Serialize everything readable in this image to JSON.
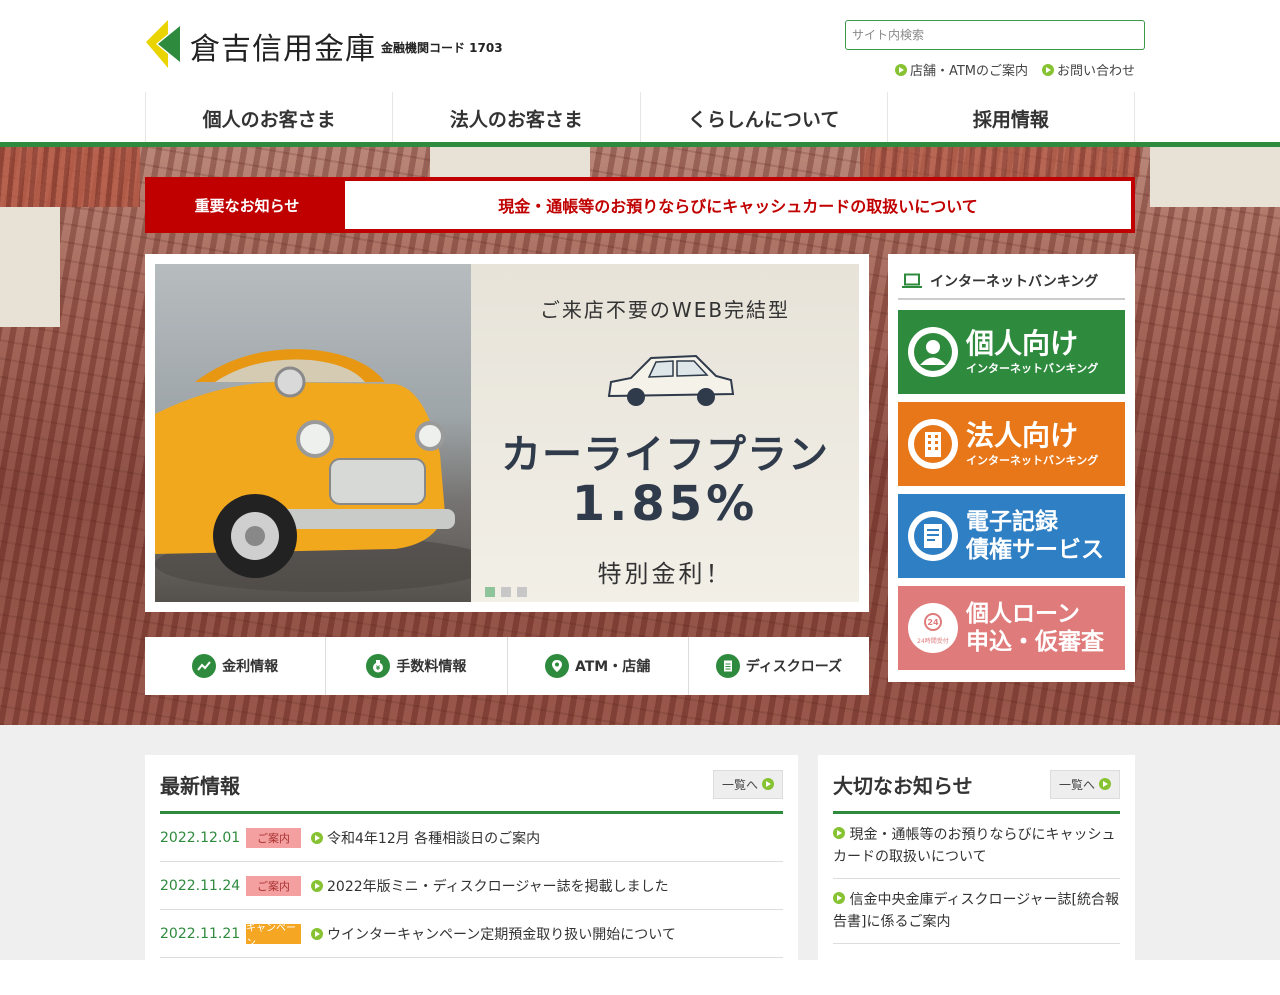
{
  "header": {
    "logo_name": "倉吉信用金庫",
    "bank_code": "金融機関コード 1703",
    "search_placeholder": "サイト内検索",
    "util_links": [
      "店舗・ATMのご案内",
      "お問い合わせ"
    ]
  },
  "nav": [
    "個人のお客さま",
    "法人のお客さま",
    "くらしんについて",
    "採用情報"
  ],
  "notice": {
    "label": "重要なお知らせ",
    "text": "現金・通帳等のお預りならびにキャッシュカードの取扱いについて"
  },
  "slider": {
    "subtitle": "ご来店不要のWEB完結型",
    "title": "カーライフプラン",
    "rate": "1.85%",
    "note": "特別金利！",
    "dots": 3,
    "active_dot": 0
  },
  "quick_links": [
    {
      "label": "金利情報",
      "icon": "chart-icon"
    },
    {
      "label": "手数料情報",
      "icon": "money-bag-icon"
    },
    {
      "label": "ATM・店舗",
      "icon": "map-pin-icon"
    },
    {
      "label": "ディスクローズ",
      "icon": "document-icon"
    }
  ],
  "internet_banking": {
    "heading": "インターネットバンキング",
    "buttons": [
      {
        "title": "個人向け",
        "sub": "インターネットバンキング",
        "color": "#2e8b3e",
        "icon": "person-icon"
      },
      {
        "title": "法人向け",
        "sub": "インターネットバンキング",
        "color": "#e8771a",
        "icon": "building-icon"
      },
      {
        "line1": "電子記録",
        "line2": "債権サービス",
        "color": "#2f7fc4",
        "icon": "e-document-icon"
      },
      {
        "line1": "個人ローン",
        "line2": "申込・仮審査",
        "color": "#e07b7b",
        "icon": "24h-clock-icon",
        "badge": "24時間受付"
      }
    ]
  },
  "news": {
    "title": "最新情報",
    "more": "一覧へ",
    "items": [
      {
        "date": "2022.12.01",
        "tag": "ご案内",
        "tag_color": "#f4a0a0",
        "title": "令和4年12月 各種相談日のご案内"
      },
      {
        "date": "2022.11.24",
        "tag": "ご案内",
        "tag_color": "#f4a0a0",
        "title": "2022年版ミニ・ディスクロージャー誌を掲載しました"
      },
      {
        "date": "2022.11.21",
        "tag": "キャンペーン",
        "tag_color": "#f5a623",
        "title": "ウインターキャンペーン定期預金取り扱い開始について"
      }
    ]
  },
  "important": {
    "title": "大切なお知らせ",
    "more": "一覧へ",
    "items": [
      "現金・通帳等のお預りならびにキャッシュカードの取扱いについて",
      "信金中央金庫ディスクロージャー誌[統合報告書]に係るご案内"
    ]
  }
}
